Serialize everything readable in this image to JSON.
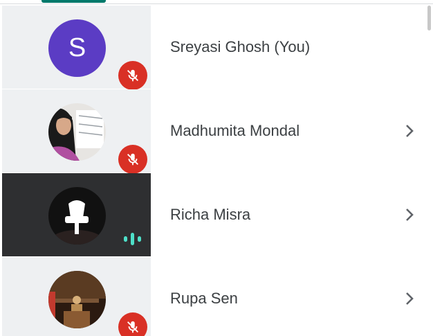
{
  "participants": [
    {
      "name": "Sreyasi Ghosh (You)",
      "avatar_initial": "S",
      "avatar_type": "initial",
      "mic_state": "muted",
      "speaking": false,
      "has_details": false
    },
    {
      "name": "Madhumita Mondal",
      "avatar_type": "photo",
      "mic_state": "muted",
      "speaking": false,
      "has_details": true
    },
    {
      "name": "Richa Misra",
      "avatar_type": "photo",
      "mic_state": "active",
      "speaking": true,
      "has_details": true
    },
    {
      "name": "Rupa Sen",
      "avatar_type": "photo",
      "mic_state": "muted",
      "speaking": false,
      "has_details": true
    }
  ],
  "colors": {
    "accent": "#00796b",
    "avatar_initial_bg": "#5b3cc4",
    "mic_muted_bg": "#d93025",
    "speaking_indicator": "#4ee0c9",
    "active_tile_bg": "#2e2f31",
    "tile_bg": "#eef0f2"
  },
  "icons": {
    "muted": "mic-off-icon",
    "speaking": "audio-level-icon",
    "details": "chevron-right-icon"
  }
}
